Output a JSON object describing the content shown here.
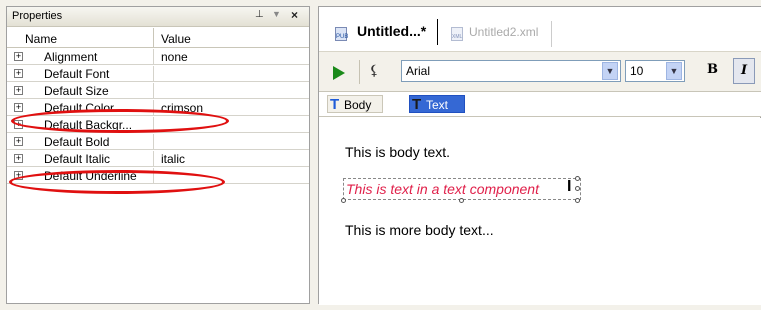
{
  "properties_panel": {
    "title": "Properties",
    "pin_icon": "pin-icon",
    "close_glyph": "×",
    "columns": {
      "name": "Name",
      "value": "Value"
    },
    "rows": [
      {
        "name": "Alignment",
        "value": "none"
      },
      {
        "name": "Default Font",
        "value": ""
      },
      {
        "name": "Default Size",
        "value": ""
      },
      {
        "name": "Default Color",
        "value": "crimson"
      },
      {
        "name": "Default Backgr...",
        "value": ""
      },
      {
        "name": "Default Bold",
        "value": ""
      },
      {
        "name": "Default Italic",
        "value": "italic"
      },
      {
        "name": "Default Underline",
        "value": ""
      }
    ],
    "highlight_color": "#e01010"
  },
  "editor": {
    "tabs": [
      {
        "label": "Untitled...*",
        "active": true
      },
      {
        "label": "Untitled2.xml",
        "active": false
      }
    ],
    "toolbar": {
      "font": "Arial",
      "size": "10",
      "bold_label": "B",
      "italic_label": "I"
    },
    "breadcrumb": {
      "body": "Body",
      "text": "Text"
    },
    "content": {
      "body_text_1": "This is body text.",
      "text_component": "This is text in a text component",
      "body_text_2": "This is more body text..."
    },
    "colors": {
      "play": "#1a8a1a",
      "italic_text": "#e0204a",
      "selected_crumb": "#3568d4"
    }
  }
}
